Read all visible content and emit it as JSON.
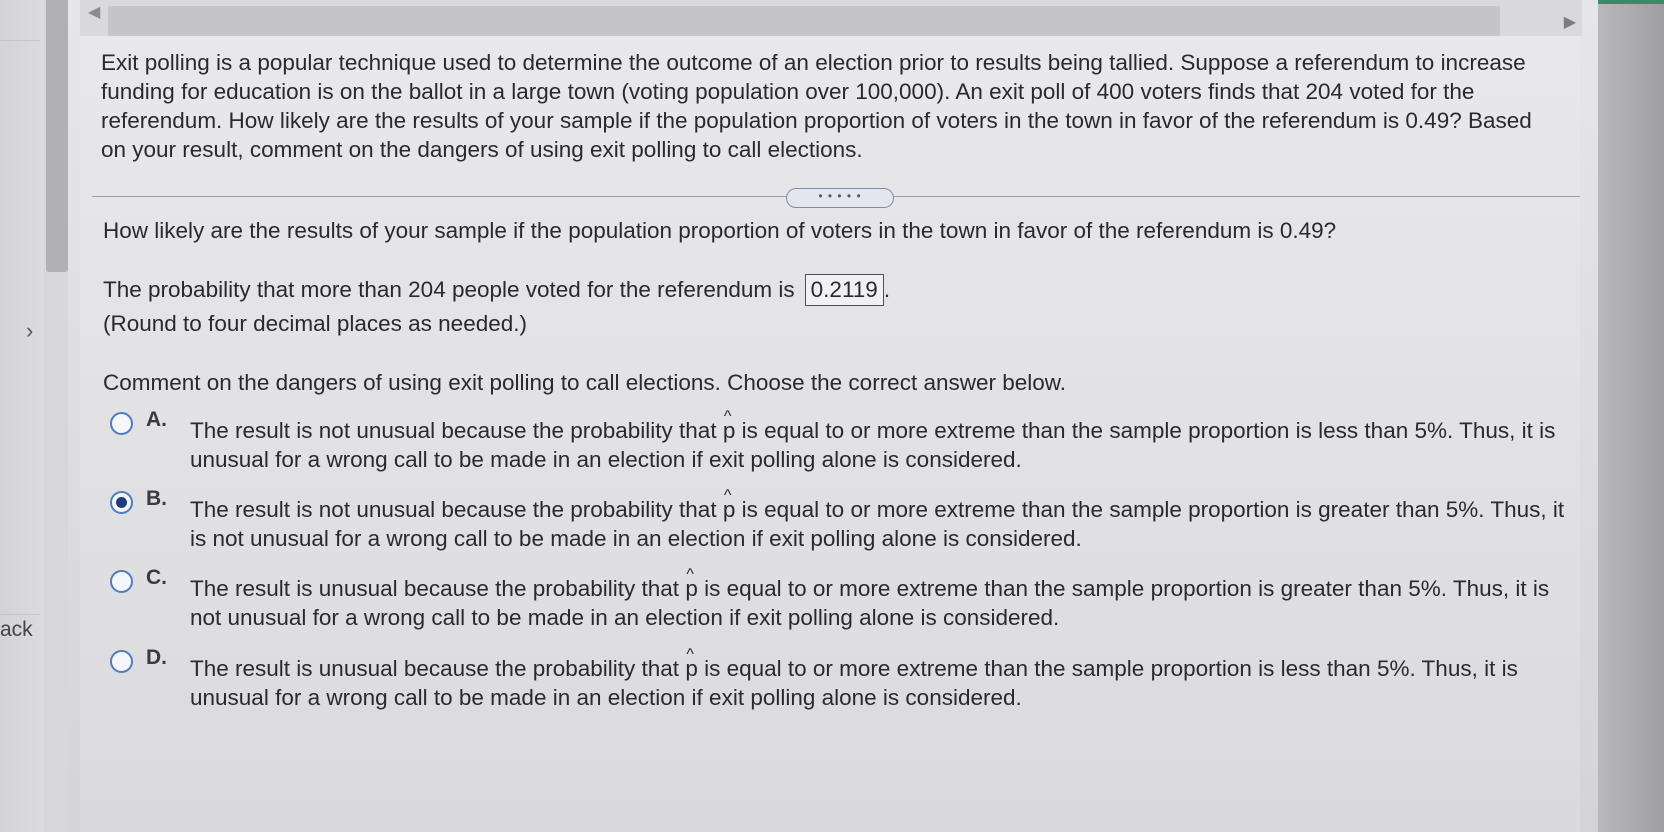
{
  "nav": {
    "left_partial_text": "ack",
    "left_chevron": "chevron-right-icon",
    "scroll_left": "caret-left-icon",
    "scroll_right": "caret-right-icon"
  },
  "question": {
    "text": "Exit polling is a popular technique used to determine the outcome of an election prior to results being tallied. Suppose a referendum to increase funding for education is on the ballot in a large town (voting population over 100,000). An exit poll of 400 voters finds that 204 voted for the referendum. How likely are the results of your sample if the population proportion of voters in the town in favor of the referendum is 0.49? Based on your result, comment on the dangers of using exit polling to call elections."
  },
  "divider_handle": "• • • • •",
  "part1": {
    "prompt": "How likely are the results of your sample if the population proportion of voters in the town in favor of the referendum is 0.49?",
    "answer_prefix": "The probability that more than 204 people voted for the referendum is",
    "answer_value": "0.2119",
    "answer_suffix": ".",
    "round_note": "(Round to four decimal places as needed.)"
  },
  "part2": {
    "prompt": "Comment on the dangers of using exit polling to call elections. Choose the correct answer below.",
    "options": [
      {
        "letter": "A.",
        "pre": "The result is not unusual because the probability that",
        "symbol": "p",
        "post": "is equal to or more extreme than the sample proportion is less than 5%. Thus, it is unusual for a wrong call to be made in an election if exit polling alone is considered.",
        "selected": false
      },
      {
        "letter": "B.",
        "pre": "The result is not unusual because the probability that",
        "symbol": "p",
        "post": "is equal to or more extreme than the sample proportion is greater than 5%. Thus, it is not unusual for a wrong call to be made in an election if exit polling alone is considered.",
        "selected": true
      },
      {
        "letter": "C.",
        "pre": "The result is unusual because the probability that",
        "symbol": "p",
        "post": "is equal to or more extreme than the sample proportion is greater than 5%. Thus, it is not unusual for a wrong call to be made in an election if exit polling alone is considered.",
        "selected": false
      },
      {
        "letter": "D.",
        "pre": "The result is unusual because the probability that",
        "symbol": "p",
        "post": "is equal to or more extreme than the sample proportion is less than 5%. Thus, it is unusual for a wrong call to be made in an election if exit polling alone is considered.",
        "selected": false
      }
    ]
  },
  "colors": {
    "radio_border": "#4e7ec1",
    "radio_selected": "#1e3e7a",
    "accent": "#3b8a67"
  }
}
